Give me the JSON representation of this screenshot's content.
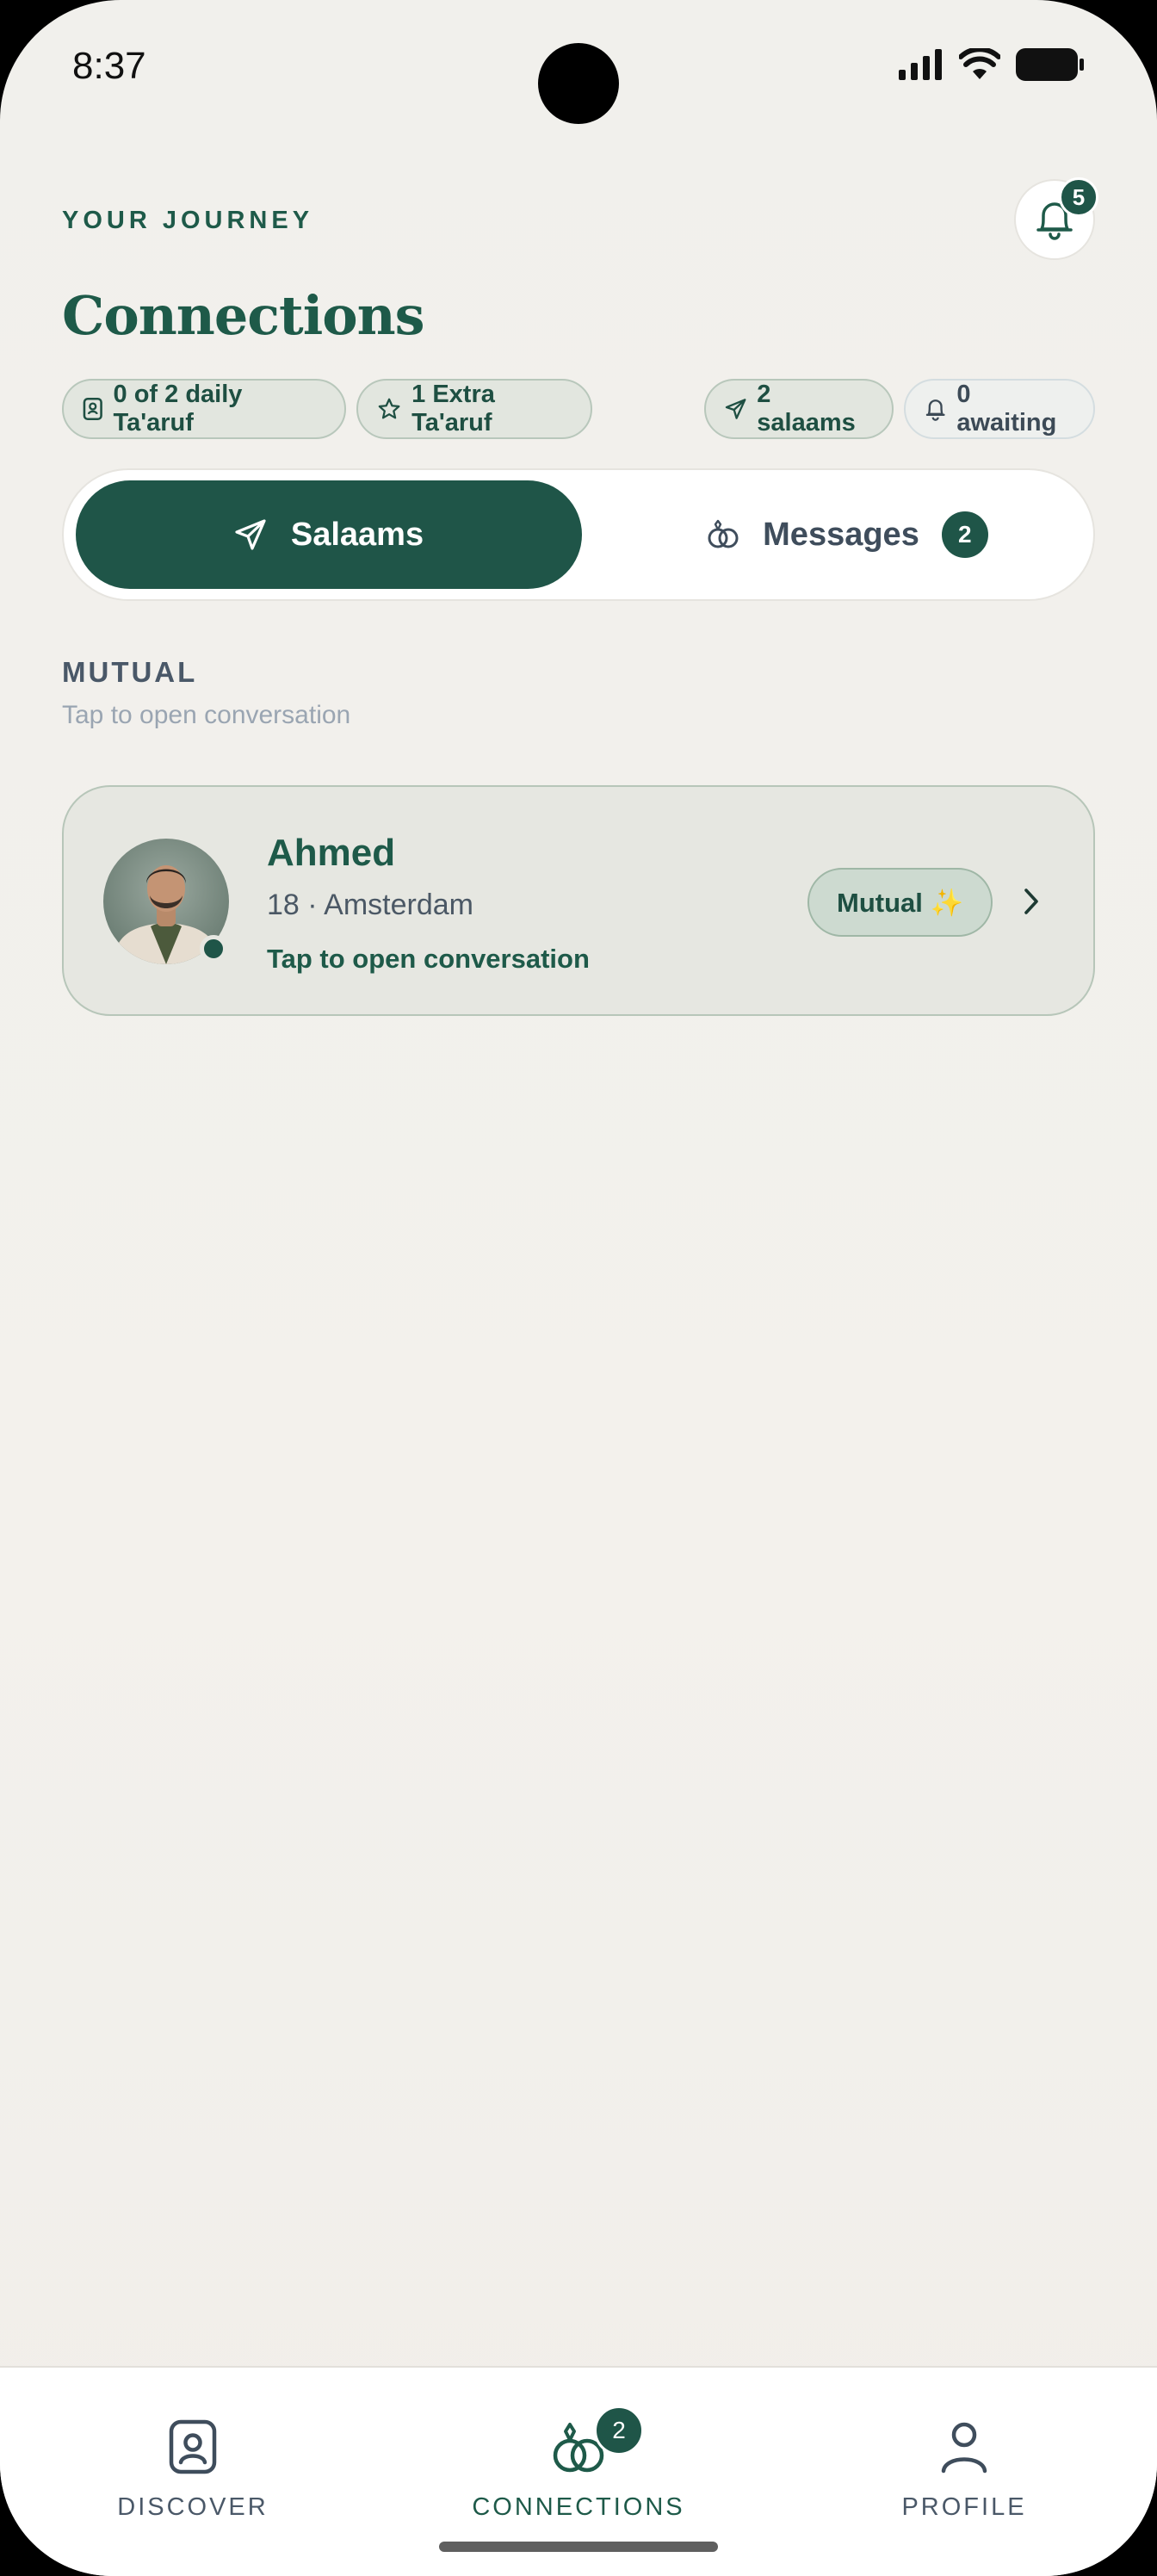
{
  "status_bar": {
    "time": "8:37"
  },
  "header": {
    "eyebrow": "YOUR JOURNEY",
    "title": "Connections",
    "notification_count": "5"
  },
  "chips": [
    {
      "label": "0 of 2 daily Ta'aruf",
      "icon": "id-card-icon"
    },
    {
      "label": "1 Extra Ta'aruf",
      "icon": "star-icon"
    },
    {
      "label": "2 salaams",
      "icon": "send-icon"
    },
    {
      "label": "0 awaiting",
      "icon": "bell-icon"
    }
  ],
  "tabs": {
    "salaams": "Salaams",
    "messages": "Messages",
    "messages_count": "2",
    "active": "salaams"
  },
  "section": {
    "label": "MUTUAL",
    "subtitle": "Tap to open conversation"
  },
  "cards": [
    {
      "name": "Ahmed",
      "meta": "18 · Amsterdam",
      "cta": "Tap to open conversation",
      "badge": "Mutual ✨",
      "online": true
    }
  ],
  "bottom_nav": {
    "items": [
      {
        "label": "DISCOVER",
        "icon": "profile-card-icon"
      },
      {
        "label": "CONNECTIONS",
        "icon": "rings-icon",
        "badge": "2",
        "active": true
      },
      {
        "label": "PROFILE",
        "icon": "person-icon"
      }
    ]
  },
  "colors": {
    "brand": "#1f5548",
    "background": "#f2f0ec",
    "text_muted": "#4a5868"
  }
}
